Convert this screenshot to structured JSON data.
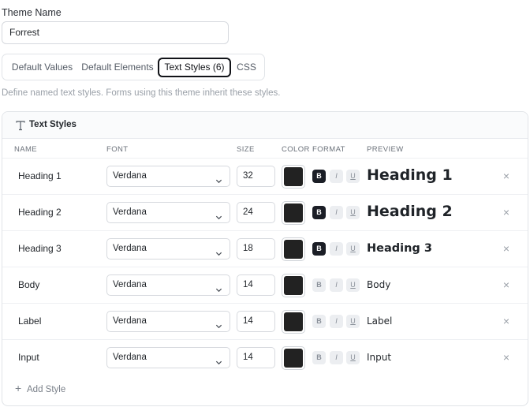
{
  "theme_name": {
    "label": "Theme Name",
    "value": "Forrest"
  },
  "tabs": [
    {
      "label": "Default Values",
      "active": false
    },
    {
      "label": "Default Elements",
      "active": false
    },
    {
      "label": "Text Styles (6)",
      "active": true
    },
    {
      "label": "CSS",
      "active": false
    }
  ],
  "hint": "Define named text styles. Forms using this theme inherit these styles.",
  "panel": {
    "title": "Text Styles",
    "icon": "text-type-icon",
    "columns": {
      "name": "NAME",
      "font": "FONT",
      "size": "SIZE",
      "color": "COLOR",
      "format": "FORMAT",
      "preview": "PREVIEW"
    },
    "format_labels": {
      "bold": "B",
      "italic": "I",
      "underline": "U"
    },
    "delete_symbol": "×",
    "rows": [
      {
        "name": "Heading 1",
        "font": "Verdana",
        "size": "32",
        "color": "#222222",
        "bold": true,
        "italic": false,
        "underline": false,
        "preview": "Heading 1"
      },
      {
        "name": "Heading 2",
        "font": "Verdana",
        "size": "24",
        "color": "#222222",
        "bold": true,
        "italic": false,
        "underline": false,
        "preview": "Heading 2"
      },
      {
        "name": "Heading 3",
        "font": "Verdana",
        "size": "18",
        "color": "#222222",
        "bold": true,
        "italic": false,
        "underline": false,
        "preview": "Heading 3"
      },
      {
        "name": "Body",
        "font": "Verdana",
        "size": "14",
        "color": "#222222",
        "bold": false,
        "italic": false,
        "underline": false,
        "preview": "Body"
      },
      {
        "name": "Label",
        "font": "Verdana",
        "size": "14",
        "color": "#222222",
        "bold": false,
        "italic": false,
        "underline": false,
        "preview": "Label"
      },
      {
        "name": "Input",
        "font": "Verdana",
        "size": "14",
        "color": "#222222",
        "bold": false,
        "italic": false,
        "underline": false,
        "preview": "Input"
      }
    ],
    "add_label": "Add Style"
  },
  "colors": {
    "active_format_bg": "#1b1e26",
    "swatch": "#222222",
    "accent_border": "#111318"
  }
}
